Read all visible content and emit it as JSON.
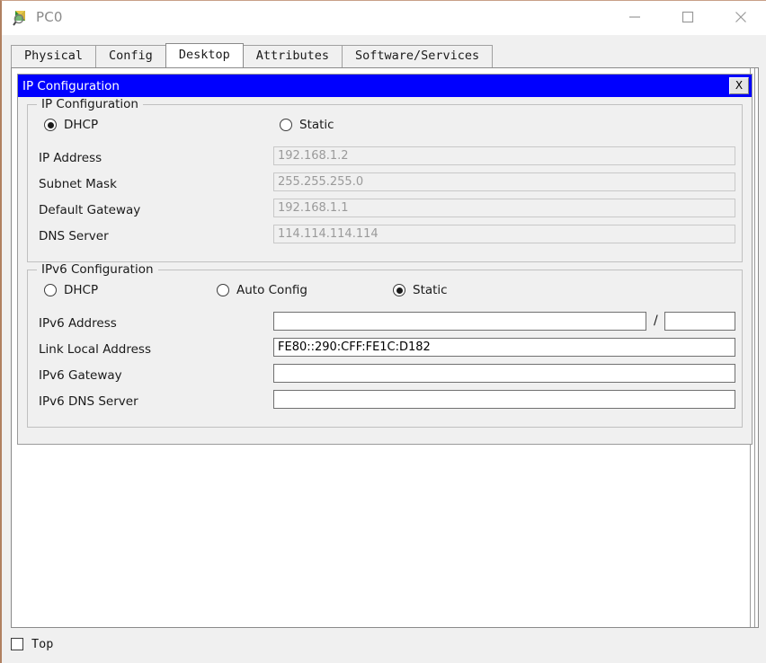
{
  "window": {
    "title": "PC0",
    "icon": "packet-tracer-device-icon",
    "controls": {
      "minimize": "minimize-icon",
      "maximize": "maximize-icon",
      "close": "close-icon"
    }
  },
  "tabs": [
    {
      "label": "Physical",
      "active": false
    },
    {
      "label": "Config",
      "active": false
    },
    {
      "label": "Desktop",
      "active": true
    },
    {
      "label": "Attributes",
      "active": false
    },
    {
      "label": "Software/Services",
      "active": false
    }
  ],
  "dialog": {
    "title": "IP Configuration",
    "close_label": "X",
    "ipv4_group": {
      "legend": "IP Configuration",
      "mode_options": [
        {
          "label": "DHCP",
          "selected": true
        },
        {
          "label": "Static",
          "selected": false
        }
      ],
      "fields": [
        {
          "label": "IP Address",
          "value": "192.168.1.2",
          "disabled": true
        },
        {
          "label": "Subnet Mask",
          "value": "255.255.255.0",
          "disabled": true
        },
        {
          "label": "Default Gateway",
          "value": "192.168.1.1",
          "disabled": true
        },
        {
          "label": "DNS Server",
          "value": "114.114.114.114",
          "disabled": true
        }
      ]
    },
    "ipv6_group": {
      "legend": "IPv6 Configuration",
      "mode_options": [
        {
          "label": "DHCP",
          "selected": false
        },
        {
          "label": "Auto Config",
          "selected": false
        },
        {
          "label": "Static",
          "selected": true
        }
      ],
      "address_field": {
        "label": "IPv6 Address",
        "value": "",
        "prefix": "",
        "separator": "/"
      },
      "fields": [
        {
          "label": "Link Local Address",
          "value": "FE80::290:CFF:FE1C:D182",
          "disabled": false
        },
        {
          "label": "IPv6 Gateway",
          "value": "",
          "disabled": false
        },
        {
          "label": "IPv6 DNS Server",
          "value": "",
          "disabled": false
        }
      ]
    }
  },
  "bottom": {
    "top_checkbox_label": "Top",
    "top_checkbox_checked": false
  },
  "colors": {
    "dialog_titlebar": "#0000FF",
    "dialog_title_text": "#FFFFFF",
    "window_bg": "#F0F0F0",
    "content_bg": "#FFFFFF",
    "disabled_text": "#9A9A9A",
    "border_accent": "#B08060"
  }
}
